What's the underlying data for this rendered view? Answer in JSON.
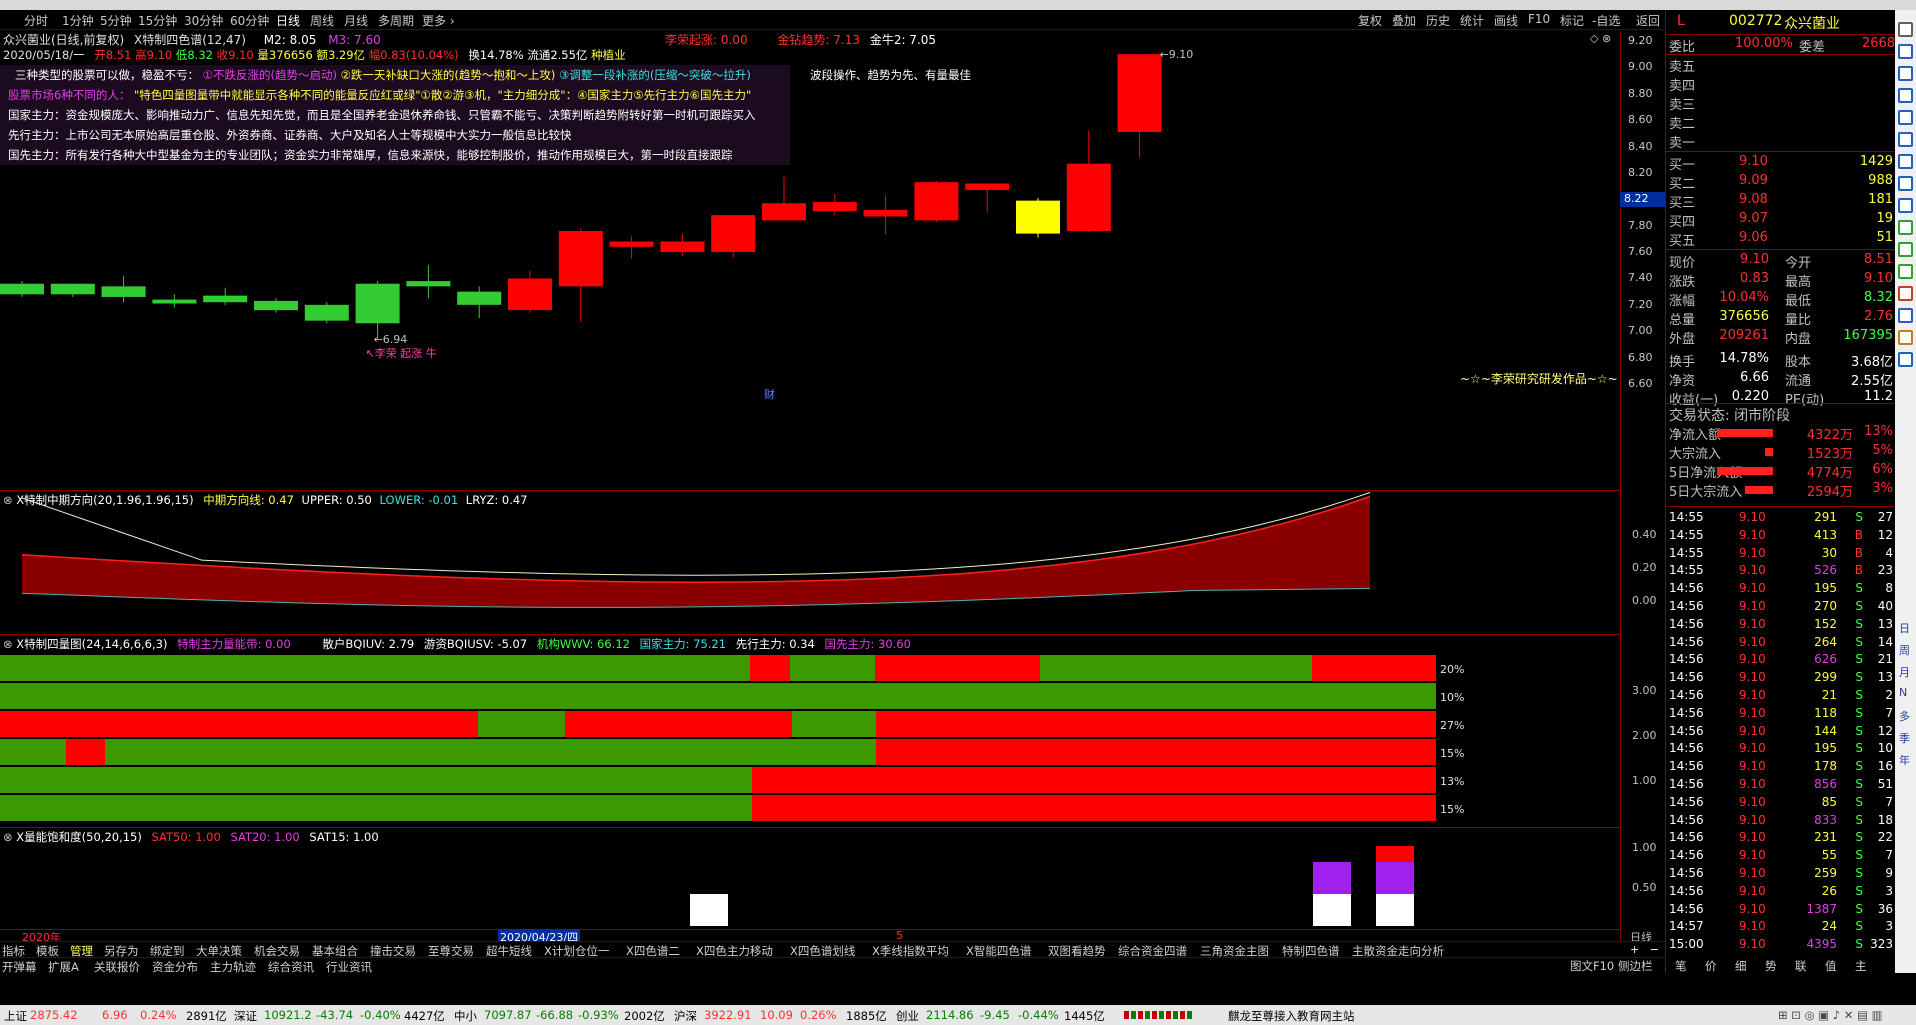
{
  "periods": [
    "分时",
    "1分钟",
    "5分钟",
    "15分钟",
    "30分钟",
    "60分钟",
    "日线",
    "周线",
    "月线",
    "多周期",
    "更多"
  ],
  "active_period": "日线",
  "toolbar": [
    "复权",
    "叠加",
    "历史",
    "统计",
    "画线",
    "F10",
    "标记",
    "-自选",
    "返回"
  ],
  "header": {
    "line1_title": "众兴菌业(日线,前复权)",
    "line1_indicator": "X特制四色谱(12,47)",
    "m2": "M2: 8.05",
    "m3": "M3: 7.60",
    "date": "2020/05/18/一",
    "open": "开8.51",
    "high": "高9.10",
    "low": "低8.32",
    "close": "收9.10",
    "volume": "量376656",
    "amount": "额3.29亿",
    "change": "幅0.83(10.04%)",
    "turnover": "换14.78%",
    "float": "流通2.55亿",
    "industry": "种植业",
    "signal1": "李荣起涨: 0.00",
    "signal2": "金钻趋势: 7.13",
    "signal3": "金牛2: 7.05"
  },
  "info": {
    "l1a": "三种类型的股票可以做，稳盈不亏：",
    "l1b": "①不跌反涨的(趋势～启动)",
    "l1c": "②跌一天补缺口大涨的(趋势～抱和～上攻)",
    "l1d": "③调整一段补涨的(压缩～突破～拉升)",
    "l1e": "波段操作、趋势为先、有量最佳",
    "l2a": "股票市场6种不同的人：",
    "l2b": "\"特色四量图量带中就能显示各种不同的能量反应红或绿\"①散②游③机，\"主力细分成\"：④国家主力⑤先行主力⑥国先主力\"",
    "l3": "国家主力：资金规模庞大、影响推动力广、信息先知先觉，而且是全国养老金退休养命钱、只管霸不能亏、决策判断趋势附转好第一时机可跟踪买入",
    "l4": "先行主力：上市公司无本原始高层重仓股、外资券商、证券商、大户及知名人士等规模中大实力一般信息比较快",
    "l5": "国先主力：所有发行各种大中型基金为主的专业团队；资金实力非常雄厚，信息来源快，能够控制股价，推动作用规模巨大，第一时段直接跟踪"
  },
  "kline": {
    "candles": [
      {
        "o": 7.36,
        "c": 7.28,
        "h": 7.38,
        "l": 7.26
      },
      {
        "o": 7.36,
        "c": 7.28,
        "h": 7.36,
        "l": 7.26
      },
      {
        "o": 7.34,
        "c": 7.26,
        "h": 7.42,
        "l": 7.22
      },
      {
        "o": 7.24,
        "c": 7.21,
        "h": 7.28,
        "l": 7.18
      },
      {
        "o": 7.22,
        "c": 7.27,
        "h": 7.33,
        "l": 7.2
      },
      {
        "o": 7.23,
        "c": 7.16,
        "h": 7.25,
        "l": 7.14
      },
      {
        "o": 7.2,
        "c": 7.08,
        "h": 7.22,
        "l": 7.06
      },
      {
        "o": 7.36,
        "c": 7.06,
        "h": 7.38,
        "l": 6.94
      },
      {
        "o": 7.34,
        "c": 7.38,
        "h": 7.5,
        "l": 7.25
      },
      {
        "o": 7.3,
        "c": 7.2,
        "h": 7.34,
        "l": 7.1
      },
      {
        "o": 7.16,
        "c": 7.4,
        "h": 7.46,
        "l": 7.14
      },
      {
        "o": 7.34,
        "c": 7.76,
        "h": 7.78,
        "l": 7.07
      },
      {
        "o": 7.64,
        "c": 7.68,
        "h": 7.72,
        "l": 7.55
      },
      {
        "o": 7.6,
        "c": 7.68,
        "h": 7.74,
        "l": 7.57
      },
      {
        "o": 7.6,
        "c": 7.88,
        "h": 7.88,
        "l": 7.56
      },
      {
        "o": 7.84,
        "c": 7.97,
        "h": 8.17,
        "l": 7.84
      },
      {
        "o": 7.91,
        "c": 7.98,
        "h": 8.04,
        "l": 7.88
      },
      {
        "o": 7.87,
        "c": 7.92,
        "h": 8.03,
        "l": 7.74
      },
      {
        "o": 7.84,
        "c": 8.13,
        "h": 8.14,
        "l": 7.83
      },
      {
        "o": 8.07,
        "c": 8.12,
        "h": 8.12,
        "l": 7.9
      },
      {
        "o": 7.99,
        "c": 7.74,
        "h": 8.01,
        "l": 7.71
      },
      {
        "o": 7.76,
        "c": 8.27,
        "h": 8.52,
        "l": 7.75
      },
      {
        "o": 8.51,
        "c": 9.1,
        "h": 9.1,
        "l": 8.32
      }
    ],
    "candle_colors": [
      "green",
      "green",
      "green",
      "green",
      "green",
      "green",
      "green",
      "green",
      "green",
      "green",
      "red",
      "red",
      "red",
      "red",
      "red",
      "red",
      "red",
      "red",
      "red",
      "red",
      "yellow",
      "red",
      "red"
    ],
    "ylabels": [
      "9.20",
      "9.00",
      "8.80",
      "8.60",
      "8.40",
      "8.20",
      "8.00",
      "7.80",
      "7.60",
      "7.40",
      "7.20",
      "7.00",
      "6.80",
      "6.60"
    ],
    "high_label": "9.10",
    "low_label": "6.94",
    "low_text": "李荣 起涨 牛",
    "current": "8.22",
    "watermark": "~☆~李荣研究研发作品~☆~",
    "cai": "财"
  },
  "pane2": {
    "title": "X特制中期方向(20,1.96,1.96,15)",
    "v1": "中期方向线: 0.47",
    "v2": "UPPER: 0.50",
    "v3": "LOWER: -0.01",
    "v4": "LRYZ: 0.47",
    "ylabels": [
      "0.40",
      "0.20",
      "0.00"
    ]
  },
  "pane3": {
    "title": "X特制四量图(24,14,6,6,6,3)",
    "v1": "特制主力量能带: 0.00",
    "v2": "散户BQIUV: 2.79",
    "v3": "游资BQIUSV: -5.07",
    "v4": "机构WWV: 66.12",
    "v5": "国家主力: 75.21",
    "v6": "先行主力: 0.34",
    "v7": "国先主力: 30.60",
    "right_labels": [
      "20%",
      "10%",
      "27%",
      "15%",
      "13%",
      "15%"
    ],
    "ylabels": [
      "3.00",
      "2.00",
      "1.00"
    ]
  },
  "pane4": {
    "title": "X量能饱和度(50,20,15)",
    "v1": "SAT50: 1.00",
    "v2": "SAT20: 1.00",
    "v3": "SAT15: 1.00",
    "ylabels": [
      "1.00",
      "0.50"
    ]
  },
  "dates": {
    "d1": "2020年",
    "d2": "2020/04/23/四",
    "d3": "5",
    "axis": "日线"
  },
  "bottom_tabs": [
    "指标",
    "模板",
    "管理",
    "另存为",
    "绑定到",
    "大单决策",
    "机会交易",
    "基本组合",
    "撞击交易",
    "至尊交易",
    "超牛短线",
    "X计划仓位一",
    "X四色谱二",
    "X四色主力移动",
    "X四色谱划线",
    "X季线指数平均",
    "X智能四色谱",
    "双图看趋势",
    "综合资金四谱",
    "三角资金主图",
    "特制四色谱",
    "主散资金走向分析"
  ],
  "bottom_tabs2": [
    "开弹幕",
    "扩展A",
    "关联报价",
    "资金分布",
    "主力轨迹",
    "综合资讯",
    "行业资讯"
  ],
  "bottom_right": [
    "图文F10",
    "侧边栏",
    "笔",
    "价",
    "细",
    "势",
    "联",
    "值",
    "主"
  ],
  "rp": {
    "code": "002772",
    "name": "众兴菌业",
    "L": "L",
    "weibi_label": "委比",
    "weibi": "100.00%",
    "weicha_label": "委差",
    "weicha": "2668",
    "sell": [
      "卖五",
      "卖四",
      "卖三",
      "卖二",
      "卖一"
    ],
    "buy": [
      {
        "l": "买一",
        "p": "9.10",
        "v": "1429"
      },
      {
        "l": "买二",
        "p": "9.09",
        "v": "988"
      },
      {
        "l": "买三",
        "p": "9.08",
        "v": "181"
      },
      {
        "l": "买四",
        "p": "9.07",
        "v": "19"
      },
      {
        "l": "买五",
        "p": "9.06",
        "v": "51"
      }
    ],
    "stats": [
      {
        "a": "现价",
        "b": "9.10",
        "c": "今开",
        "d": "8.51"
      },
      {
        "a": "涨跌",
        "b": "0.83",
        "c": "最高",
        "d": "9.10"
      },
      {
        "a": "涨幅",
        "b": "10.04%",
        "c": "最低",
        "d": "8.32"
      },
      {
        "a": "总量",
        "b": "376656",
        "c": "量比",
        "d": "2.76"
      },
      {
        "a": "外盘",
        "b": "209261",
        "c": "内盘",
        "d": "167395"
      },
      {
        "a": "换手",
        "b": "14.78%",
        "c": "股本",
        "d": "3.68亿"
      },
      {
        "a": "净资",
        "b": "6.66",
        "c": "流通",
        "d": "2.55亿"
      },
      {
        "a": "收益(一)",
        "b": "0.220",
        "c": "PE(动)",
        "d": "11.2"
      }
    ],
    "trade_status": "交易状态: 闭市阶段",
    "flows": [
      {
        "l": "净流入额",
        "v": "4322万",
        "p": "13%"
      },
      {
        "l": "大宗流入",
        "v": "1523万",
        "p": "5%"
      },
      {
        "l": "5日净流入额",
        "v": "4774万",
        "p": "6%"
      },
      {
        "l": "5日大宗流入",
        "v": "2594万",
        "p": "3%"
      }
    ],
    "ticks": [
      [
        "14:55",
        "9.10",
        "291",
        "S",
        "27"
      ],
      [
        "14:55",
        "9.10",
        "413",
        "B",
        "12"
      ],
      [
        "14:55",
        "9.10",
        "30",
        "B",
        "4"
      ],
      [
        "14:55",
        "9.10",
        "526",
        "B",
        "23"
      ],
      [
        "14:56",
        "9.10",
        "195",
        "S",
        "8"
      ],
      [
        "14:56",
        "9.10",
        "270",
        "S",
        "40"
      ],
      [
        "14:56",
        "9.10",
        "152",
        "S",
        "13"
      ],
      [
        "14:56",
        "9.10",
        "264",
        "S",
        "14"
      ],
      [
        "14:56",
        "9.10",
        "626",
        "S",
        "21"
      ],
      [
        "14:56",
        "9.10",
        "299",
        "S",
        "13"
      ],
      [
        "14:56",
        "9.10",
        "21",
        "S",
        "2"
      ],
      [
        "14:56",
        "9.10",
        "118",
        "S",
        "7"
      ],
      [
        "14:56",
        "9.10",
        "144",
        "S",
        "12"
      ],
      [
        "14:56",
        "9.10",
        "195",
        "S",
        "10"
      ],
      [
        "14:56",
        "9.10",
        "178",
        "S",
        "16"
      ],
      [
        "14:56",
        "9.10",
        "856",
        "S",
        "51"
      ],
      [
        "14:56",
        "9.10",
        "85",
        "S",
        "7"
      ],
      [
        "14:56",
        "9.10",
        "833",
        "S",
        "18"
      ],
      [
        "14:56",
        "9.10",
        "231",
        "S",
        "22"
      ],
      [
        "14:56",
        "9.10",
        "55",
        "S",
        "7"
      ],
      [
        "14:56",
        "9.10",
        "259",
        "S",
        "9"
      ],
      [
        "14:56",
        "9.10",
        "26",
        "S",
        "3"
      ],
      [
        "14:56",
        "9.10",
        "1387",
        "S",
        "36"
      ],
      [
        "14:57",
        "9.10",
        "24",
        "S",
        "3"
      ],
      [
        "15:00",
        "9.10",
        "4395",
        "S",
        "323"
      ]
    ]
  },
  "status": {
    "sh_l": "上证",
    "sh_v": "2875.42",
    "sh_c": "6.96",
    "sh_p": "0.24%",
    "sh_a": "2891亿",
    "sz_l": "深证",
    "sz_v": "10921.2",
    "sz_c": "-43.74",
    "sz_p": "-0.40%",
    "sz_a": "4427亿",
    "zx_l": "中小",
    "zx_v": "7097.87",
    "zx_c": "-66.88",
    "zx_p": "-0.93%",
    "zx_a": "2002亿",
    "hs_l": "沪深",
    "hs_v": "3922.91",
    "hs_c": "10.09",
    "hs_p": "0.26%",
    "hs_a": "1885亿",
    "cy_l": "创业",
    "cy_v": "2114.86",
    "cy_c": "-9.45",
    "cy_p": "-0.44%",
    "cy_a": "1445亿",
    "msg": "麒龙至尊接入教育网主站"
  }
}
